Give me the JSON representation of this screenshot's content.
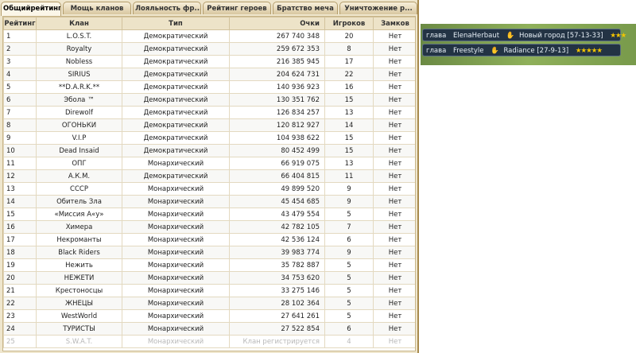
{
  "tabs": [
    "Общийрейтинг ...",
    "Мощь кланов",
    "Лояльность фр...",
    "Рейтинг героев",
    "Братство меча",
    "Уничтожение р..."
  ],
  "table": {
    "headers": [
      "Рейтинг",
      "Клан",
      "Тип",
      "Очки",
      "Игроков",
      "Замков"
    ],
    "rows": [
      [
        "1",
        "L.O.S.T.",
        "Демократический",
        "267 740 348",
        "20",
        "Нет"
      ],
      [
        "2",
        "Royalty",
        "Демократический",
        "259 672 353",
        "8",
        "Нет"
      ],
      [
        "3",
        "Nobless",
        "Демократический",
        "216 385 945",
        "17",
        "Нет"
      ],
      [
        "4",
        "SIRIUS",
        "Демократический",
        "204 624 731",
        "22",
        "Нет"
      ],
      [
        "5",
        "**D.A.R.K.**",
        "Демократический",
        "140 936 923",
        "16",
        "Нет"
      ],
      [
        "6",
        "Эбола ™",
        "Демократический",
        "130 351 762",
        "15",
        "Нет"
      ],
      [
        "7",
        "Direwolf",
        "Демократический",
        "126 834 257",
        "13",
        "Нет"
      ],
      [
        "8",
        "ОГОНЬКИ",
        "Демократический",
        "120 812 927",
        "14",
        "Нет"
      ],
      [
        "9",
        "V.I.P",
        "Демократический",
        "104 938 622",
        "15",
        "Нет"
      ],
      [
        "10",
        "Dead Insaid",
        "Демократический",
        "80 452 499",
        "15",
        "Нет"
      ],
      [
        "11",
        "ОПГ",
        "Монархический",
        "66 919 075",
        "13",
        "Нет"
      ],
      [
        "12",
        "А.К.М.",
        "Демократический",
        "66 404 815",
        "11",
        "Нет"
      ],
      [
        "13",
        "СССР",
        "Монархический",
        "49 899 520",
        "9",
        "Нет"
      ],
      [
        "14",
        "Обитель Зла",
        "Монархический",
        "45 454 685",
        "9",
        "Нет"
      ],
      [
        "15",
        "«Миссия А«у»",
        "Монархический",
        "43 479 554",
        "5",
        "Нет"
      ],
      [
        "16",
        "Химера",
        "Монархический",
        "42 782 105",
        "7",
        "Нет"
      ],
      [
        "17",
        "Некроманты",
        "Монархический",
        "42 536 124",
        "6",
        "Нет"
      ],
      [
        "18",
        "Black Riders",
        "Монархический",
        "39 983 774",
        "9",
        "Нет"
      ],
      [
        "19",
        "Нежить",
        "Монархический",
        "35 782 887",
        "5",
        "Нет"
      ],
      [
        "20",
        "НЕЖЕТИ",
        "Монархический",
        "34 753 620",
        "5",
        "Нет"
      ],
      [
        "21",
        "Крестоносцы",
        "Монархический",
        "33 275 146",
        "5",
        "Нет"
      ],
      [
        "22",
        "ЖНЕЦЫ",
        "Монархический",
        "28 102 364",
        "5",
        "Нет"
      ],
      [
        "23",
        "WestWorld",
        "Монархический",
        "27 641 261",
        "5",
        "Нет"
      ],
      [
        "24",
        "ТУРИСТЫ",
        "Монархический",
        "27 522 854",
        "6",
        "Нет"
      ],
      [
        "25",
        "S.W.A.T.",
        "Монархический",
        "Клан регистрируется",
        "4",
        "Нет"
      ]
    ]
  },
  "clan_list": [
    {
      "role": "глава",
      "name": "ElenaHerbaut",
      "clan": "Новый город [57-13-33]",
      "stars": "★★★"
    },
    {
      "role": "глава",
      "name": "Freestyle",
      "clan": "Radiance [27-9-13]",
      "stars": "★★★★★"
    }
  ],
  "icons": {
    "hand": "hand-icon",
    "star": "star-icon"
  }
}
